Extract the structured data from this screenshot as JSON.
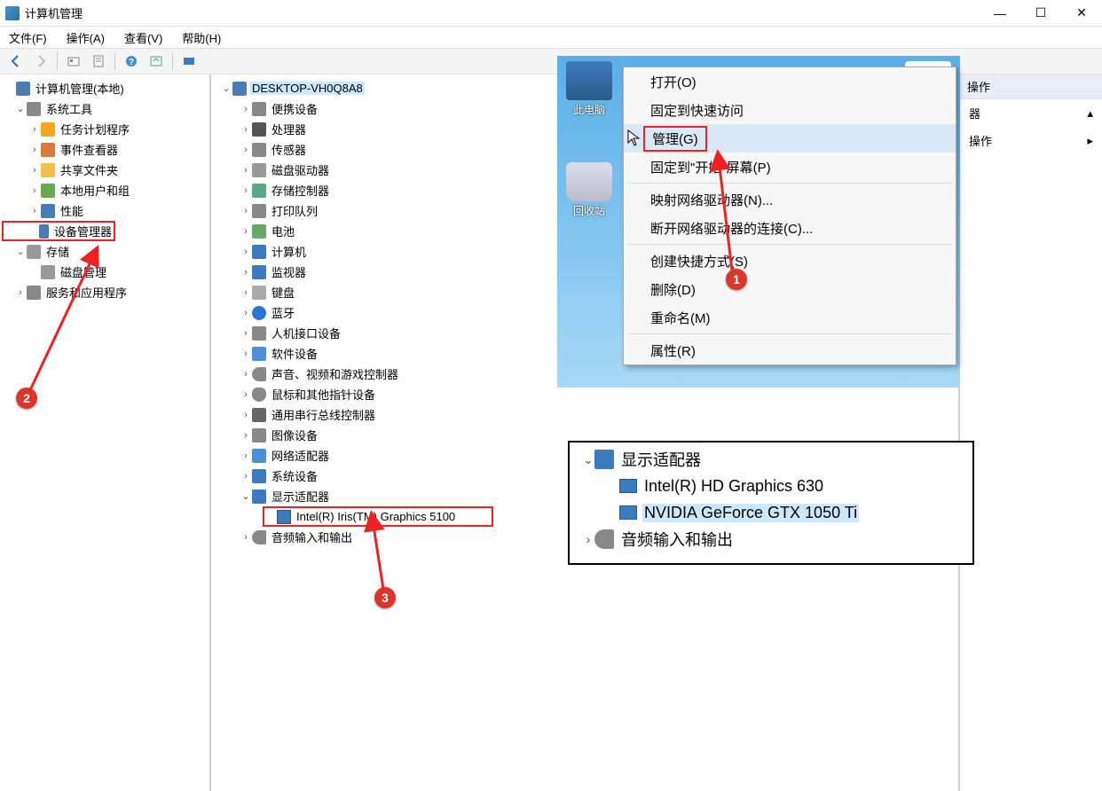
{
  "window": {
    "title": "计算机管理",
    "minimize": "—",
    "maximize": "☐",
    "close": "✕"
  },
  "menubar": {
    "file": "文件(F)",
    "action": "操作(A)",
    "view": "查看(V)",
    "help": "帮助(H)"
  },
  "left_tree": {
    "root": "计算机管理(本地)",
    "system_tools": "系统工具",
    "task_scheduler": "任务计划程序",
    "event_viewer": "事件查看器",
    "shared_folders": "共享文件夹",
    "local_users": "本地用户和组",
    "performance": "性能",
    "device_manager": "设备管理器",
    "storage": "存储",
    "disk_mgmt": "磁盘管理",
    "services": "服务和应用程序"
  },
  "devices": {
    "root": "DESKTOP-VH0Q8A8",
    "items": [
      "便携设备",
      "处理器",
      "传感器",
      "磁盘驱动器",
      "存储控制器",
      "打印队列",
      "电池",
      "计算机",
      "监视器",
      "键盘",
      "蓝牙",
      "人机接口设备",
      "软件设备",
      "声音、视频和游戏控制器",
      "鼠标和其他指针设备",
      "通用串行总线控制器",
      "图像设备",
      "网络适配器",
      "系统设备",
      "显示适配器"
    ],
    "display_adapter_child": "Intel(R) Iris(TM) Graphics 5100",
    "audio": "音频输入和输出"
  },
  "right": {
    "header": "操作",
    "item1": "器",
    "item2": "操作"
  },
  "context_menu": {
    "desktop_icon1": "此电脑",
    "desktop_icon2": "回收站",
    "open": "打开(O)",
    "pin_quick": "固定到快速访问",
    "manage": "管理(G)",
    "pin_start": "固定到\"开始\"屏幕(P)",
    "map_drive": "映射网络驱动器(N)...",
    "disconnect": "断开网络驱动器的连接(C)...",
    "shortcut": "创建快捷方式(S)",
    "delete": "删除(D)",
    "rename": "重命名(M)",
    "properties": "属性(R)"
  },
  "device_overlay": {
    "display_adapters": "显示适配器",
    "gpu1": "Intel(R) HD Graphics 630",
    "gpu2": "NVIDIA GeForce GTX 1050 Ti",
    "audio": "音频输入和输出"
  },
  "annotations": {
    "n1": "1",
    "n2": "2",
    "n3": "3"
  }
}
